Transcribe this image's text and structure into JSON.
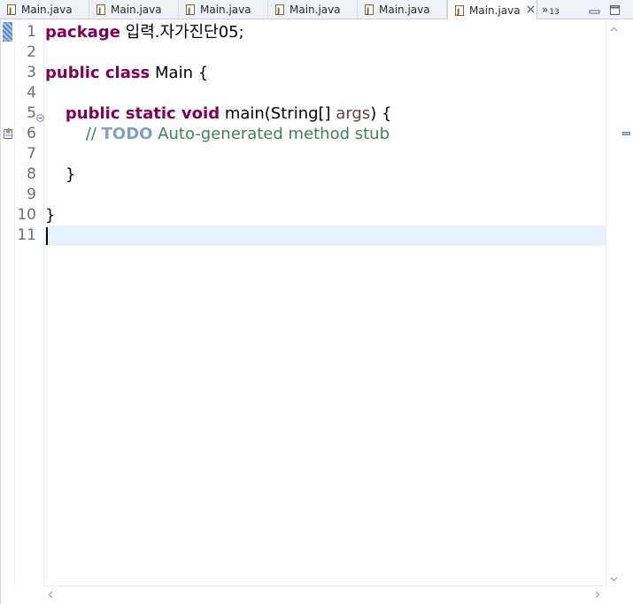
{
  "tabs": [
    {
      "label": "Main.java",
      "active": false
    },
    {
      "label": "Main.java",
      "active": false
    },
    {
      "label": "Main.java",
      "active": false
    },
    {
      "label": "Main.java",
      "active": false
    },
    {
      "label": "Main.java",
      "active": false
    },
    {
      "label": "Main.java",
      "active": true
    }
  ],
  "tab_overflow": {
    "symbol": "»",
    "count": "13"
  },
  "window_controls": {
    "minimize_icon": "minimize-icon",
    "maximize_icon": "maximize-icon"
  },
  "editor": {
    "line_numbers": [
      "1",
      "2",
      "3",
      "4",
      "5",
      "6",
      "7",
      "8",
      "9",
      "10",
      "11"
    ],
    "current_line": "11",
    "code": {
      "l1_kw": "package",
      "l1_rest": " 입력.자가진단05;",
      "l3_kw": "public class",
      "l3_rest": " Main {",
      "l5_indent": "    ",
      "l5_kw": "public static void",
      "l5_mid": " main(String[] ",
      "l5_param": "args",
      "l5_end": ") {",
      "l6_indent": "        ",
      "l6_comment_start": "// ",
      "l6_todo": "TODO",
      "l6_comment_rest": " Auto-generated method stub",
      "l8_text": "    }",
      "l10_text": "}"
    },
    "colors": {
      "keyword": "#7f0055",
      "comment": "#3f7f5f",
      "todo": "#7f9fbf",
      "param": "#6a3e3e",
      "current_line": "#e8f2fe"
    }
  }
}
